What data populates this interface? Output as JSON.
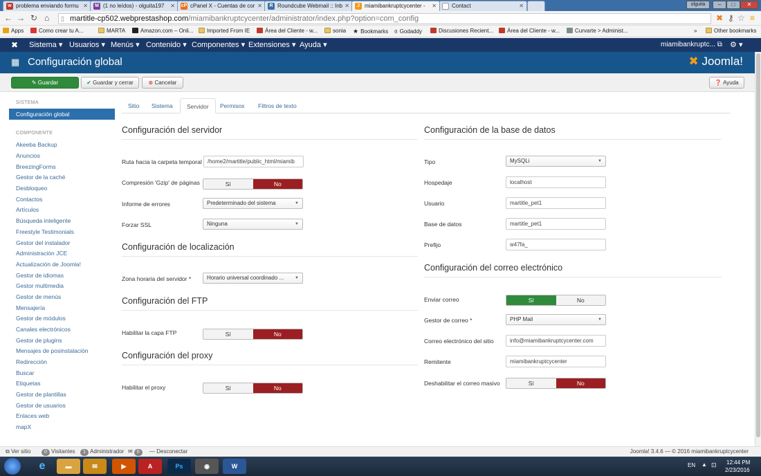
{
  "browser": {
    "tabs": [
      {
        "label": "problema enviando formu",
        "favicon": "w"
      },
      {
        "label": "(1 no leídos) - olguita197",
        "favicon": "M"
      },
      {
        "label": "cPanel X - Cuentas de cor",
        "favicon": "cP"
      },
      {
        "label": "Roundcube Webmail :: Inb",
        "favicon": "R"
      },
      {
        "label": "miamibankruptcycenter - ",
        "favicon": "J"
      },
      {
        "label": "Contact",
        "favicon": ""
      }
    ],
    "user_chip": "olguita",
    "url_host": "martitle-cp502.webprestashop.com",
    "url_path": "/miamibankruptcycenter/administrator/index.php?option=com_config",
    "bookmarks": [
      "Apps",
      "Como crear tu A...",
      "MARTA",
      "Amazon.com – Onli...",
      "Imported From IE",
      "Área del Cliente - w...",
      "sonia",
      "Bookmarks",
      "Godaddy",
      "Discusiones Recient...",
      "Área del Cliente - w...",
      "Curvarte > Administ..."
    ],
    "other_bookmarks": "Other bookmarks"
  },
  "topnav": {
    "menus": [
      "Sistema",
      "Usuarios",
      "Menús",
      "Contenido",
      "Componentes",
      "Extensiones",
      "Ayuda"
    ],
    "site": "miamibankruptc..."
  },
  "header": {
    "title": "Configuración global",
    "logo": "Joomla!"
  },
  "toolbar": {
    "save": "Guardar",
    "save_close": "Guardar y cerrar",
    "cancel": "Cancelar",
    "help": "Ayuda"
  },
  "sidebar": {
    "system_head": "SISTEMA",
    "active": "Configuración global",
    "component_head": "COMPONENTE",
    "items": [
      "Akeeba Backup",
      "Anuncios",
      "BreezingForms",
      "Gestor de la caché",
      "Desbloqueo",
      "Contactos",
      "Artículos",
      "Búsqueda inteligente",
      "Freestyle Testimonials",
      "Gestor del instalador",
      "Administración JCE",
      "Actualización de Joomla!",
      "Gestor de idiomas",
      "Gestor multimedia",
      "Gestor de menús",
      "Mensajería",
      "Gestor de módulos",
      "Canales electrónicos",
      "Gestor de plugins",
      "Mensajes de posinstalación",
      "Redirección",
      "Buscar",
      "Etiquetas",
      "Gestor de plantillas",
      "Gestor de usuarios",
      "Enlaces web",
      "mapX"
    ]
  },
  "tabs": [
    "Sitio",
    "Sistema",
    "Servidor",
    "Permisos",
    "Filtros de texto"
  ],
  "server": {
    "title": "Configuración del servidor",
    "tmp_label": "Ruta hacia la carpeta temporal",
    "tmp_value": "/home2/martitle/public_html/miamib",
    "gzip_label": "Compresión 'Gzip' de páginas",
    "errors_label": "Informe de errores",
    "errors_value": "Predeterminado del sistema",
    "ssl_label": "Forzar SSL",
    "ssl_value": "Ninguna"
  },
  "locale": {
    "title": "Configuración de localización",
    "tz_label": "Zona horaria del servidor *",
    "tz_value": "Horario universal coordinado ..."
  },
  "ftp": {
    "title": "Configuración del FTP",
    "enable_label": "Habilitar la capa FTP"
  },
  "proxy": {
    "title": "Configuración del proxy",
    "enable_label": "Habilitar el proxy"
  },
  "yes": "Sí",
  "no": "No",
  "database": {
    "title": "Configuración de la base de datos",
    "type_label": "Tipo",
    "type_value": "MySQLi",
    "host_label": "Hospedaje",
    "host_value": "localhost",
    "user_label": "Usuario",
    "user_value": "martitle_pet1",
    "db_label": "Base de datos",
    "db_value": "martitle_pet1",
    "prefix_label": "Prefijo",
    "prefix_value": "w47fa_"
  },
  "mail": {
    "title": "Configuración del correo electrónico",
    "send_label": "Enviar correo",
    "mailer_label": "Gestor de correo *",
    "mailer_value": "PHP Mail",
    "from_email_label": "Correo electrónico del sitio",
    "from_email_value": "info@miamibankruptcycenter.com",
    "from_name_label": "Remitente",
    "from_name_value": "miamibankruptcycenter",
    "mass_label": "Deshabilitar el correo masivo"
  },
  "status": {
    "view_site": "Ver sitio",
    "visitors_count": "0",
    "visitors": "Visitantes",
    "admins_count": "1",
    "admins": "Administrador",
    "messages_count": "0",
    "logout": "Desconectar",
    "version": "Joomla! 3.4.6 — © 2016 miamibankruptcycenter"
  },
  "taskbar": {
    "lang": "EN",
    "time": "12:44 PM",
    "date": "2/23/2016"
  },
  "colors": {
    "nav": "#1a3867",
    "header": "#17568c",
    "green": "#2f8b3b",
    "red": "#9b1f22",
    "link": "#3a6a9a"
  }
}
